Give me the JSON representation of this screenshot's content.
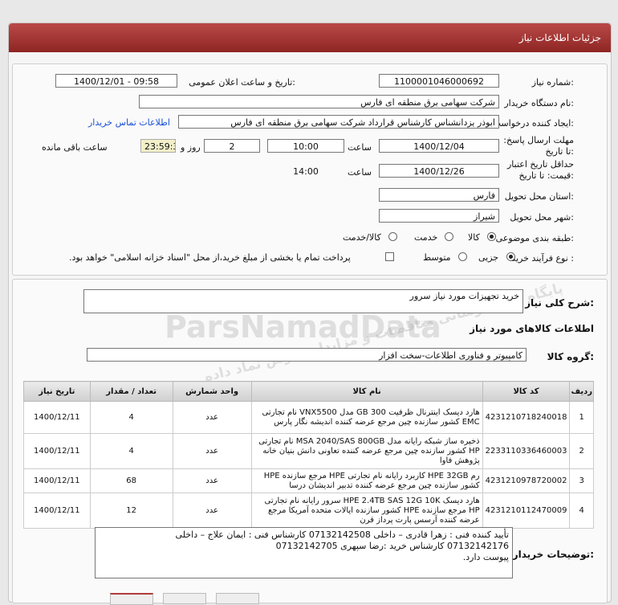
{
  "header": {
    "title": "جزئیات اطلاعات نیاز"
  },
  "form": {
    "need_number_label": "شماره نیاز:",
    "need_number": "1100001046000692",
    "announce_label": "تاریخ و ساعت اعلان عمومی:",
    "announce_value": "1400/12/01 - 09:58",
    "buyer_org_label": "نام دستگاه خریدار:",
    "buyer_org": "شرکت سهامی برق منطقه ای فارس",
    "creator_label": "ایجاد کننده درخواست:",
    "creator": "ابوذر  یزدانشناس کارشناس قرارداد شرکت سهامی برق منطقه ای فارس",
    "contact_link": "اطلاعات تماس خریدار",
    "reply_deadline_label": "مهلت ارسال پاسخ: تا تاریخ:",
    "reply_date": "1400/12/04",
    "time_label": "ساعت",
    "reply_time": "10:00",
    "days_value": "2",
    "days_label": "روز و",
    "remaining_time": "23:59:31",
    "remaining_label": "ساعت باقی مانده",
    "validity_label": "حداقل تاریخ اعتبار قیمت: تا تاریخ:",
    "validity_date": "1400/12/26",
    "validity_time_label": "ساعت",
    "validity_time": "14:00",
    "province_label": "استان محل تحویل:",
    "province": "فارس",
    "city_label": "شهر محل تحویل:",
    "city": "شیراز",
    "category_label": "طبقه بندی موضوعی:",
    "category_options": [
      "کالا",
      "خدمت",
      "کالا/خدمت"
    ],
    "category_selected": "کالا",
    "process_label": "نوع فرآیند خرید :",
    "process_options": [
      "جزیی",
      "متوسط"
    ],
    "process_selected": "جزیی",
    "payment_note": "پرداخت تمام یا بخشی از مبلغ خرید،از محل \"اسناد خزانه اسلامی\" خواهد بود."
  },
  "summary": {
    "general_desc_label": "شرح کلی نیاز:",
    "general_desc": "خرید تجهیزات مورد نیاز سرور",
    "goods_info_title": "اطلاعات کالاهای مورد نیاز",
    "goods_group_label": "گروه کالا:",
    "goods_group": "کامپیوتر و فناوری اطلاعات-سخت افزار"
  },
  "table": {
    "headers": [
      "ردیف",
      "کد کالا",
      "نام کالا",
      "واحد شمارش",
      "تعداد / مقدار",
      "تاریخ نیاز"
    ],
    "rows": [
      {
        "row": "1",
        "code": "4231210718240018",
        "name": "هارد دیسک اینترنال ظرفیت 300 GB مدل VNX5500 نام تجارتی EMC کشور سازنده چین مرجع عرضه کننده اندیشه نگار پارس",
        "unit": "عدد",
        "qty": "4",
        "date": "1400/12/11"
      },
      {
        "row": "2",
        "code": "2233110336460003",
        "name": "ذخیره ساز شبکه رایانه مدل MSA 2040/SAS 800GB نام تجارتی HP کشور سازنده چین مرجع عرضه کننده تعاونی دانش بنیان خانه پژوهش فاوا",
        "unit": "عدد",
        "qty": "4",
        "date": "1400/12/11"
      },
      {
        "row": "3",
        "code": "4231210978720002",
        "name": "رم HPE 32GB کاربرد رایانه نام تجارتی HPE مرجع سازنده HPE کشور سازنده چین مرجع عرضه کننده تدبیر اندیشان درسا",
        "unit": "عدد",
        "qty": "68",
        "date": "1400/12/11"
      },
      {
        "row": "4",
        "code": "4231210112470009",
        "name": "هارد دیسک HPE 2.4TB SAS 12G 10K سرور رایانه نام تجارتی HP مرجع سازنده HPE کشور سازنده ایالات متحده آمریکا مرجع عرضه کننده آرسس پارت پرداز قرن",
        "unit": "عدد",
        "qty": "12",
        "date": "1400/12/11"
      }
    ]
  },
  "notes": {
    "label": "توضیحات خریدار:",
    "line1": "تأیید کننده فنی : زهرا قادری – داخلی 07132142508       کارشناس فنی : ایمان علاج – داخلی",
    "line2": "07132142176                کارشناس خرید :رضا سپهری 07132142705",
    "line3": "پیوست دارد."
  },
  "watermark": {
    "line1": "ParsNamadData",
    "line2": "پایگاه اطلاع رسانی مناقصات و مزایدات پارس نماد داده"
  }
}
